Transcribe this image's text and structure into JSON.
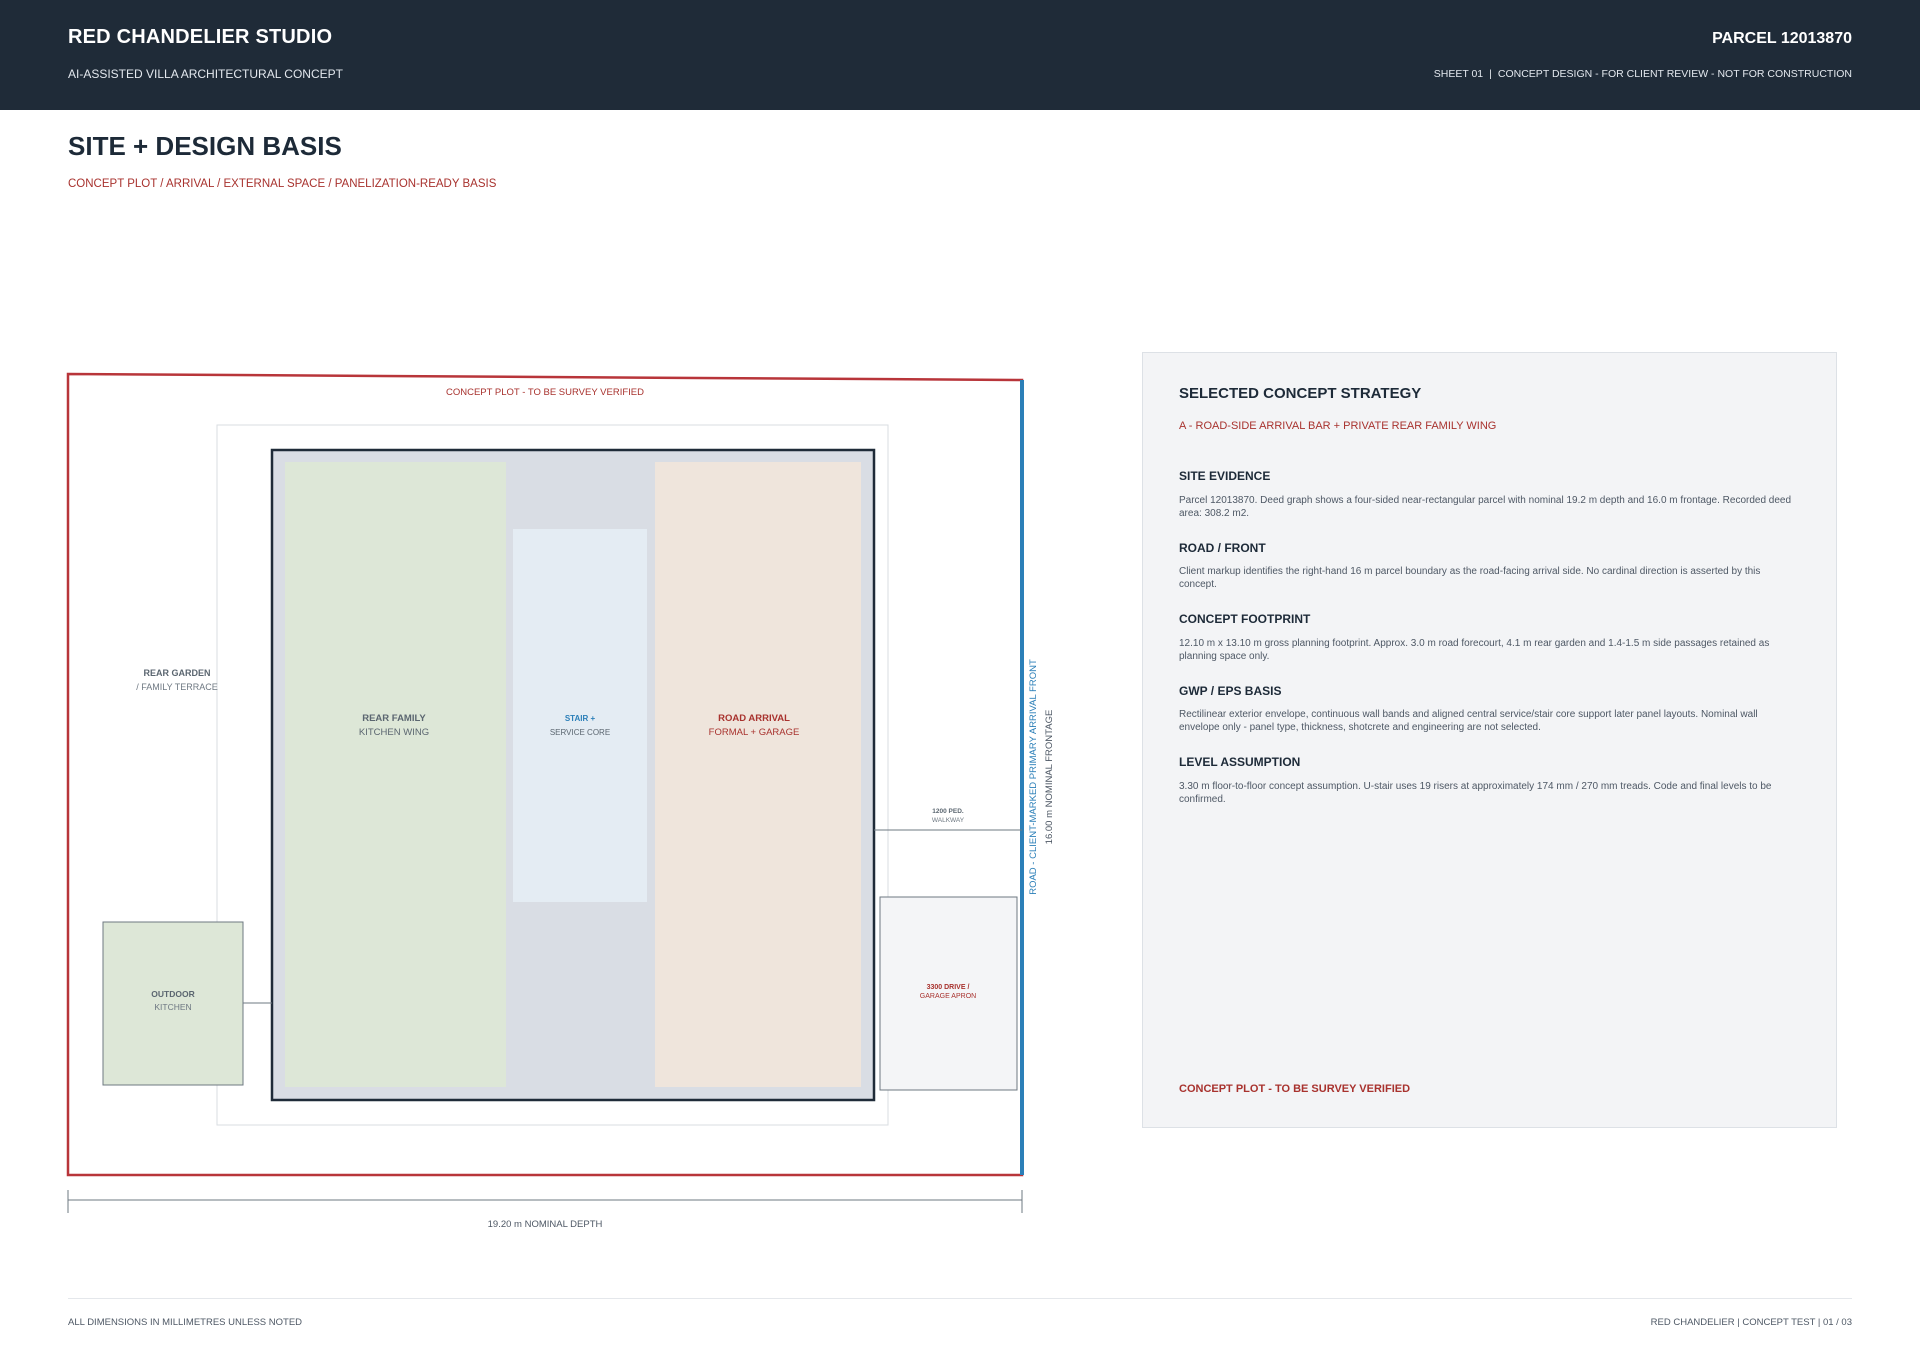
{
  "header": {
    "studio": "RED CHANDELIER STUDIO",
    "subtitle": "AI-ASSISTED VILLA ARCHITECTURAL CONCEPT",
    "parcel": "PARCEL 12013870",
    "sheet_no": "SHEET 01",
    "sheet_status": "CONCEPT DESIGN - FOR CLIENT REVIEW - NOT FOR CONSTRUCTION"
  },
  "page": {
    "title": "SITE + DESIGN BASIS",
    "subtitle": "CONCEPT PLOT / ARRIVAL / EXTERNAL SPACE / PANELIZATION-READY BASIS"
  },
  "plan": {
    "plot_label": "CONCEPT PLOT - TO BE SURVEY VERIFIED",
    "rear_garden": {
      "title": "REAR GARDEN",
      "sub": "/ FAMILY TERRACE"
    },
    "rear_family": {
      "title": "REAR FAMILY",
      "sub": "KITCHEN WING"
    },
    "stair": {
      "title": "STAIR +",
      "sub": "SERVICE CORE"
    },
    "road_arrival": {
      "title": "ROAD ARRIVAL",
      "sub": "FORMAL + GARAGE"
    },
    "walkway": {
      "title": "1200 PED.",
      "sub": "WALKWAY"
    },
    "drive": {
      "title": "3300 DRIVE /",
      "sub": "GARAGE APRON"
    },
    "outdoor": {
      "title": "OUTDOOR",
      "sub": "KITCHEN"
    },
    "road_label": "ROAD - CLIENT-MARKED PRIMARY ARRIVAL FRONT",
    "frontage_label": "16.00 m NOMINAL FRONTAGE",
    "depth_label": "19.20 m NOMINAL DEPTH",
    "colors": {
      "plot_boundary": "#b8353a",
      "road_front": "#2b7fb8",
      "footprint_outline": "#1f2b38",
      "rear_wing_fill": "#dde7d7",
      "core_fill": "#e4ecf3",
      "arrival_fill": "#efe5dc"
    }
  },
  "panel": {
    "title": "SELECTED CONCEPT STRATEGY",
    "strategy": "A - ROAD-SIDE ARRIVAL BAR + PRIVATE REAR FAMILY WING",
    "sections": [
      {
        "heading": "SITE EVIDENCE",
        "body": "Parcel 12013870. Deed graph shows a four-sided near-rectangular parcel with nominal 19.2 m depth and 16.0 m frontage. Recorded deed area: 308.2 m2."
      },
      {
        "heading": "ROAD / FRONT",
        "body": "Client markup identifies the right-hand 16 m parcel boundary as the road-facing arrival side. No cardinal direction is asserted by this concept."
      },
      {
        "heading": "CONCEPT FOOTPRINT",
        "body": "12.10 m x 13.10 m gross planning footprint. Approx. 3.0 m road forecourt, 4.1 m rear garden and 1.4-1.5 m side passages retained as planning space only."
      },
      {
        "heading": "GWP / EPS BASIS",
        "body": "Rectilinear exterior envelope, continuous wall bands and aligned central service/stair core support later panel layouts. Nominal wall envelope only - panel type, thickness, shotcrete and engineering are not selected."
      },
      {
        "heading": "LEVEL ASSUMPTION",
        "body": "3.30 m floor-to-floor concept assumption. U-stair uses 19 risers at approximately 174 mm / 270 mm treads. Code and final levels to be confirmed."
      }
    ],
    "note": "CONCEPT PLOT - TO BE SURVEY VERIFIED"
  },
  "footer": {
    "left": "ALL DIMENSIONS IN MILLIMETRES UNLESS NOTED",
    "right": "RED CHANDELIER | CONCEPT TEST | 01 / 03"
  }
}
